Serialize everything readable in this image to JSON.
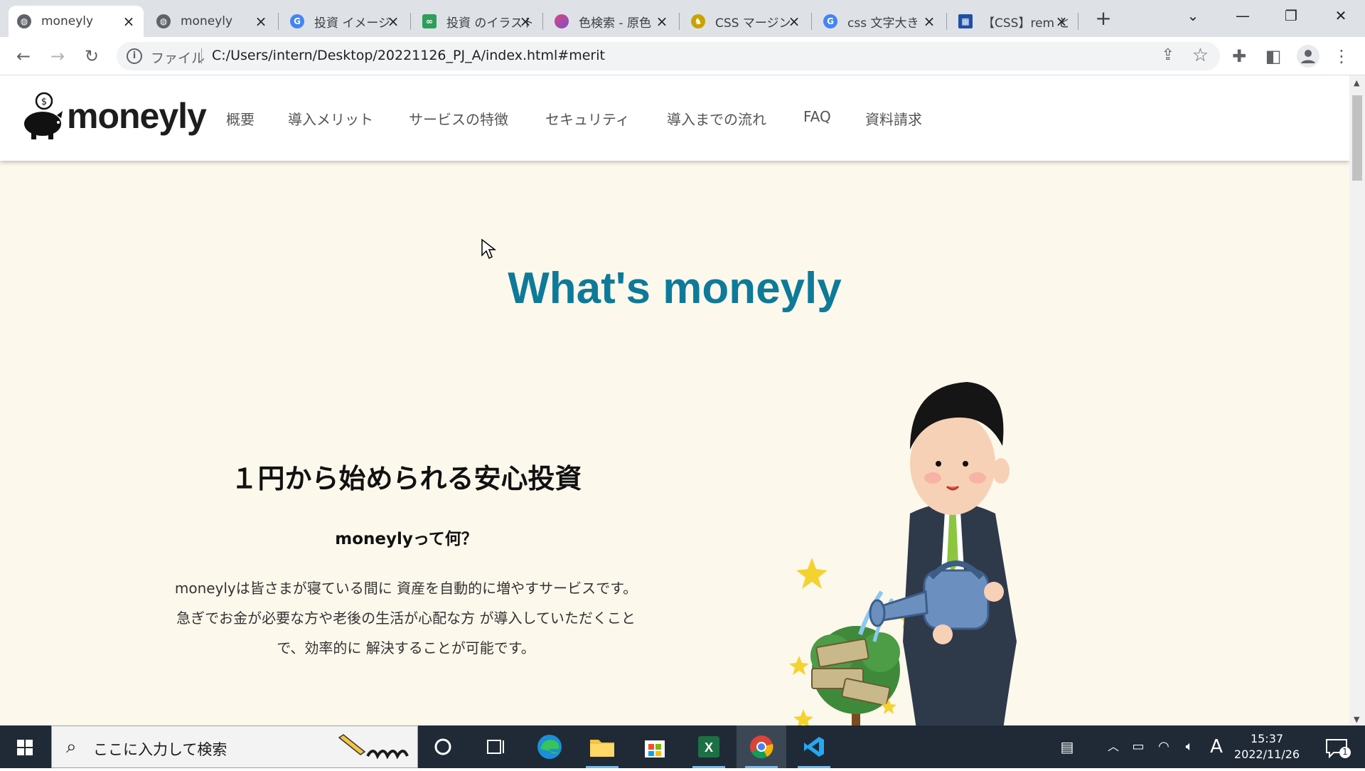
{
  "browser": {
    "tabs": [
      {
        "title": "moneyly",
        "icon": "globe-icon",
        "active": true
      },
      {
        "title": "moneyly",
        "icon": "globe-icon",
        "active": false
      },
      {
        "title": "投資 イメージ",
        "icon": "google-icon",
        "active": false
      },
      {
        "title": "投資 のイラスト",
        "icon": "irasutoya-icon",
        "active": false
      },
      {
        "title": "色検索 - 原色",
        "icon": "color-search-icon",
        "active": false
      },
      {
        "title": "CSS マージン",
        "icon": "site-icon",
        "active": false
      },
      {
        "title": "css 文字大き",
        "icon": "google-icon",
        "active": false
      },
      {
        "title": "【CSS】rem と",
        "icon": "blocks-icon",
        "active": false
      }
    ],
    "new_tab_label": "+",
    "address": {
      "scheme_label": "ファイル",
      "url": "C:/Users/intern/Desktop/20221126_PJ_A/index.html#merit"
    }
  },
  "site": {
    "logo_text": "moneyly",
    "nav": [
      "概要",
      "導入メリット",
      "サービスの特徴",
      "セキュリティ",
      "導入までの流れ",
      "FAQ",
      "資料請求"
    ],
    "hero_title": "What's moneyly",
    "section": {
      "heading": "１円から始められる安心投資",
      "subheading": "moneylyって何？",
      "body_lines": [
        "moneylyは皆さまが寝ている間に 資産を自動的に増やすサービスです。",
        "急ぎでお金が必要な方や老後の生活が心配な方 が導入していただくこと",
        "で、効率的に 解決することが可能です。"
      ]
    }
  },
  "taskbar": {
    "search_placeholder": "ここに入力して検索",
    "apps": [
      "cortana-icon",
      "task-view-icon",
      "edge-icon",
      "file-explorer-icon",
      "store-icon",
      "excel-icon",
      "chrome-icon",
      "vscode-icon"
    ],
    "ime_label": "A",
    "time": "15:37",
    "date": "2022/11/26",
    "notification_count": "1"
  },
  "colors": {
    "accent": "#0e7a99",
    "page_bg": "#fdf8ec",
    "taskbar_bg": "#1f2a36"
  }
}
